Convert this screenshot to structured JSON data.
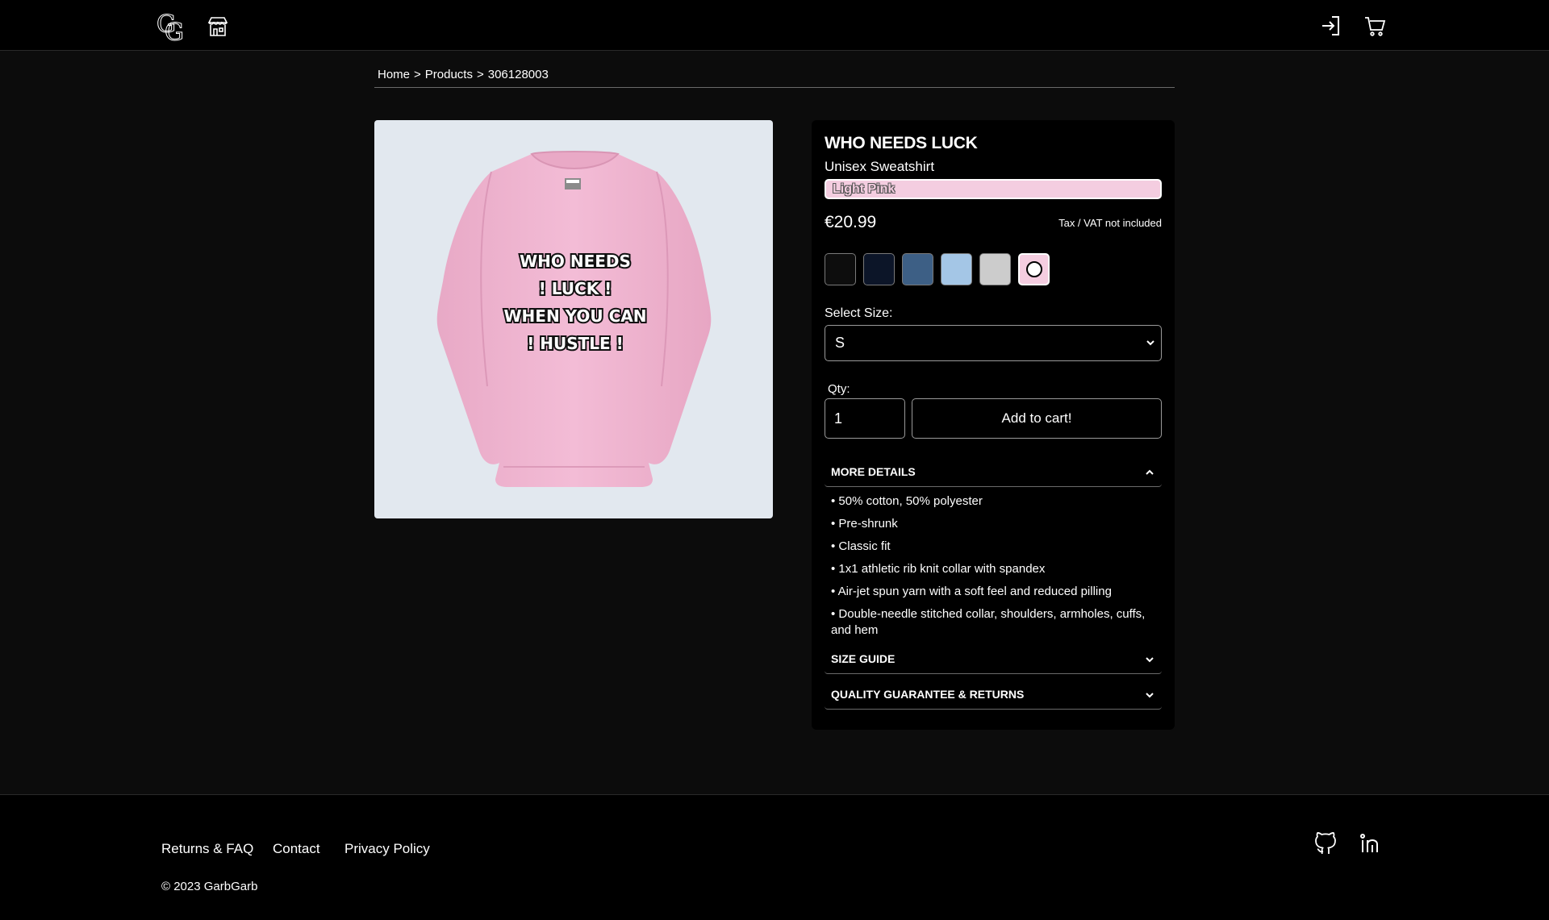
{
  "header": {
    "logo_icon": "gg-monogram-logo",
    "store_icon": "storefront-icon",
    "login_icon": "sign-in-icon",
    "cart_icon": "shopping-cart-icon"
  },
  "breadcrumb": {
    "items": [
      "Home",
      "Products",
      "306128003"
    ],
    "separator": ">"
  },
  "product": {
    "image_alt": "Pink sweatshirt",
    "print_lines": [
      "WHO NEEDS",
      "! LUCK !",
      "WHEN YOU CAN",
      "! HUSTLE !"
    ],
    "title": "WHO NEEDS LUCK",
    "subtitle": "Unisex Sweatshirt",
    "selected_color": "Light Pink",
    "price": "€20.99",
    "tax_note": "Tax / VAT not included",
    "colors": [
      {
        "hex": "#0d0d0d",
        "selected": false
      },
      {
        "hex": "#0c1528",
        "selected": false
      },
      {
        "hex": "#3d5f85",
        "selected": false
      },
      {
        "hex": "#a4c6e6",
        "selected": false
      },
      {
        "hex": "#cccccc",
        "selected": false
      },
      {
        "hex": "#f4cde0",
        "selected": true
      }
    ],
    "size_label": "Select Size:",
    "size_value": "S",
    "qty_label": "Qty:",
    "qty_value": "1",
    "add_to_cart_label": "Add to cart!"
  },
  "accordions": {
    "more_details": {
      "label": "MORE DETAILS",
      "expanded": true,
      "items": [
        "• 50% cotton, 50% polyester",
        "• Pre-shrunk",
        "• Classic fit",
        "• 1x1 athletic rib knit collar with spandex",
        "• Air-jet spun yarn with a soft feel and reduced pilling",
        "• Double-needle stitched collar, shoulders, armholes, cuffs, and hem"
      ]
    },
    "size_guide": {
      "label": "SIZE GUIDE",
      "expanded": false
    },
    "quality": {
      "label": "QUALITY GUARANTEE & RETURNS",
      "expanded": false
    }
  },
  "footer": {
    "links": [
      "Returns & FAQ",
      "Contact",
      "Privacy Policy"
    ],
    "copyright": "© 2023 GarbGarb",
    "social_icons": [
      "github-icon",
      "linkedin-icon"
    ]
  },
  "colors": {
    "background": "#0c0c0c",
    "header": "#000000",
    "accent_pink": "#f4cde0",
    "image_bg": "#e2e8ef"
  }
}
